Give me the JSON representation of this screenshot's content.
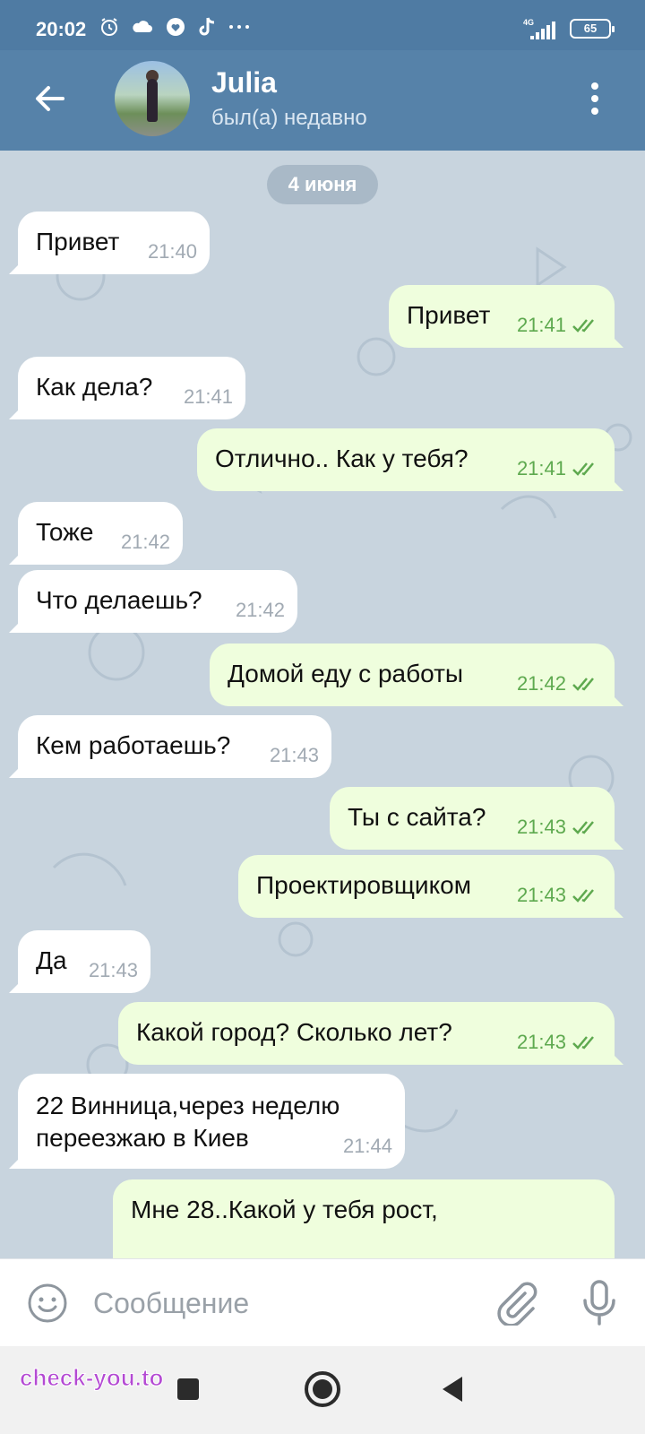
{
  "status_bar": {
    "time": "20:02",
    "network": "4G",
    "battery": "65",
    "icons": [
      "alarm-icon",
      "cloud-icon",
      "heart-app-icon",
      "tiktok-icon",
      "more-dots-icon"
    ]
  },
  "header": {
    "contact_name": "Julia",
    "contact_status": "был(а) недавно"
  },
  "chat": {
    "date_label": "4 июня",
    "messages": [
      {
        "dir": "in",
        "text": "Привет",
        "time": "21:40"
      },
      {
        "dir": "out",
        "text": "Привет",
        "time": "21:41"
      },
      {
        "dir": "in",
        "text": "Как дела?",
        "time": "21:41"
      },
      {
        "dir": "out",
        "text": "Отлично.. Как у тебя?",
        "time": "21:41"
      },
      {
        "dir": "in",
        "text": "Тоже",
        "time": "21:42"
      },
      {
        "dir": "in",
        "text": "Что делаешь?",
        "time": "21:42"
      },
      {
        "dir": "out",
        "text": "Домой еду с работы",
        "time": "21:42"
      },
      {
        "dir": "in",
        "text": "Кем работаешь?",
        "time": "21:43"
      },
      {
        "dir": "out",
        "text": "Ты с сайта?",
        "time": "21:43"
      },
      {
        "dir": "out",
        "text": "Проектировщиком",
        "time": "21:43"
      },
      {
        "dir": "in",
        "text": "Да",
        "time": "21:43"
      },
      {
        "dir": "out",
        "text": "Какой город? Сколько лет?",
        "time": "21:43"
      },
      {
        "dir": "in",
        "text": "22 Винница,через неделю переезжаю в Киев",
        "time": "21:44"
      },
      {
        "dir": "out",
        "text": "Мне 28..Какой у тебя рост,",
        "time": ""
      }
    ]
  },
  "input": {
    "placeholder": "Сообщение",
    "value": ""
  },
  "watermark": "check-you.to",
  "colors": {
    "header": "#5682a9",
    "status_bar": "#4f7ba3",
    "chat_bg": "#c8d4de",
    "outgoing_bubble": "#effedd",
    "incoming_bubble": "#ffffff",
    "read_check": "#5ea94f"
  }
}
